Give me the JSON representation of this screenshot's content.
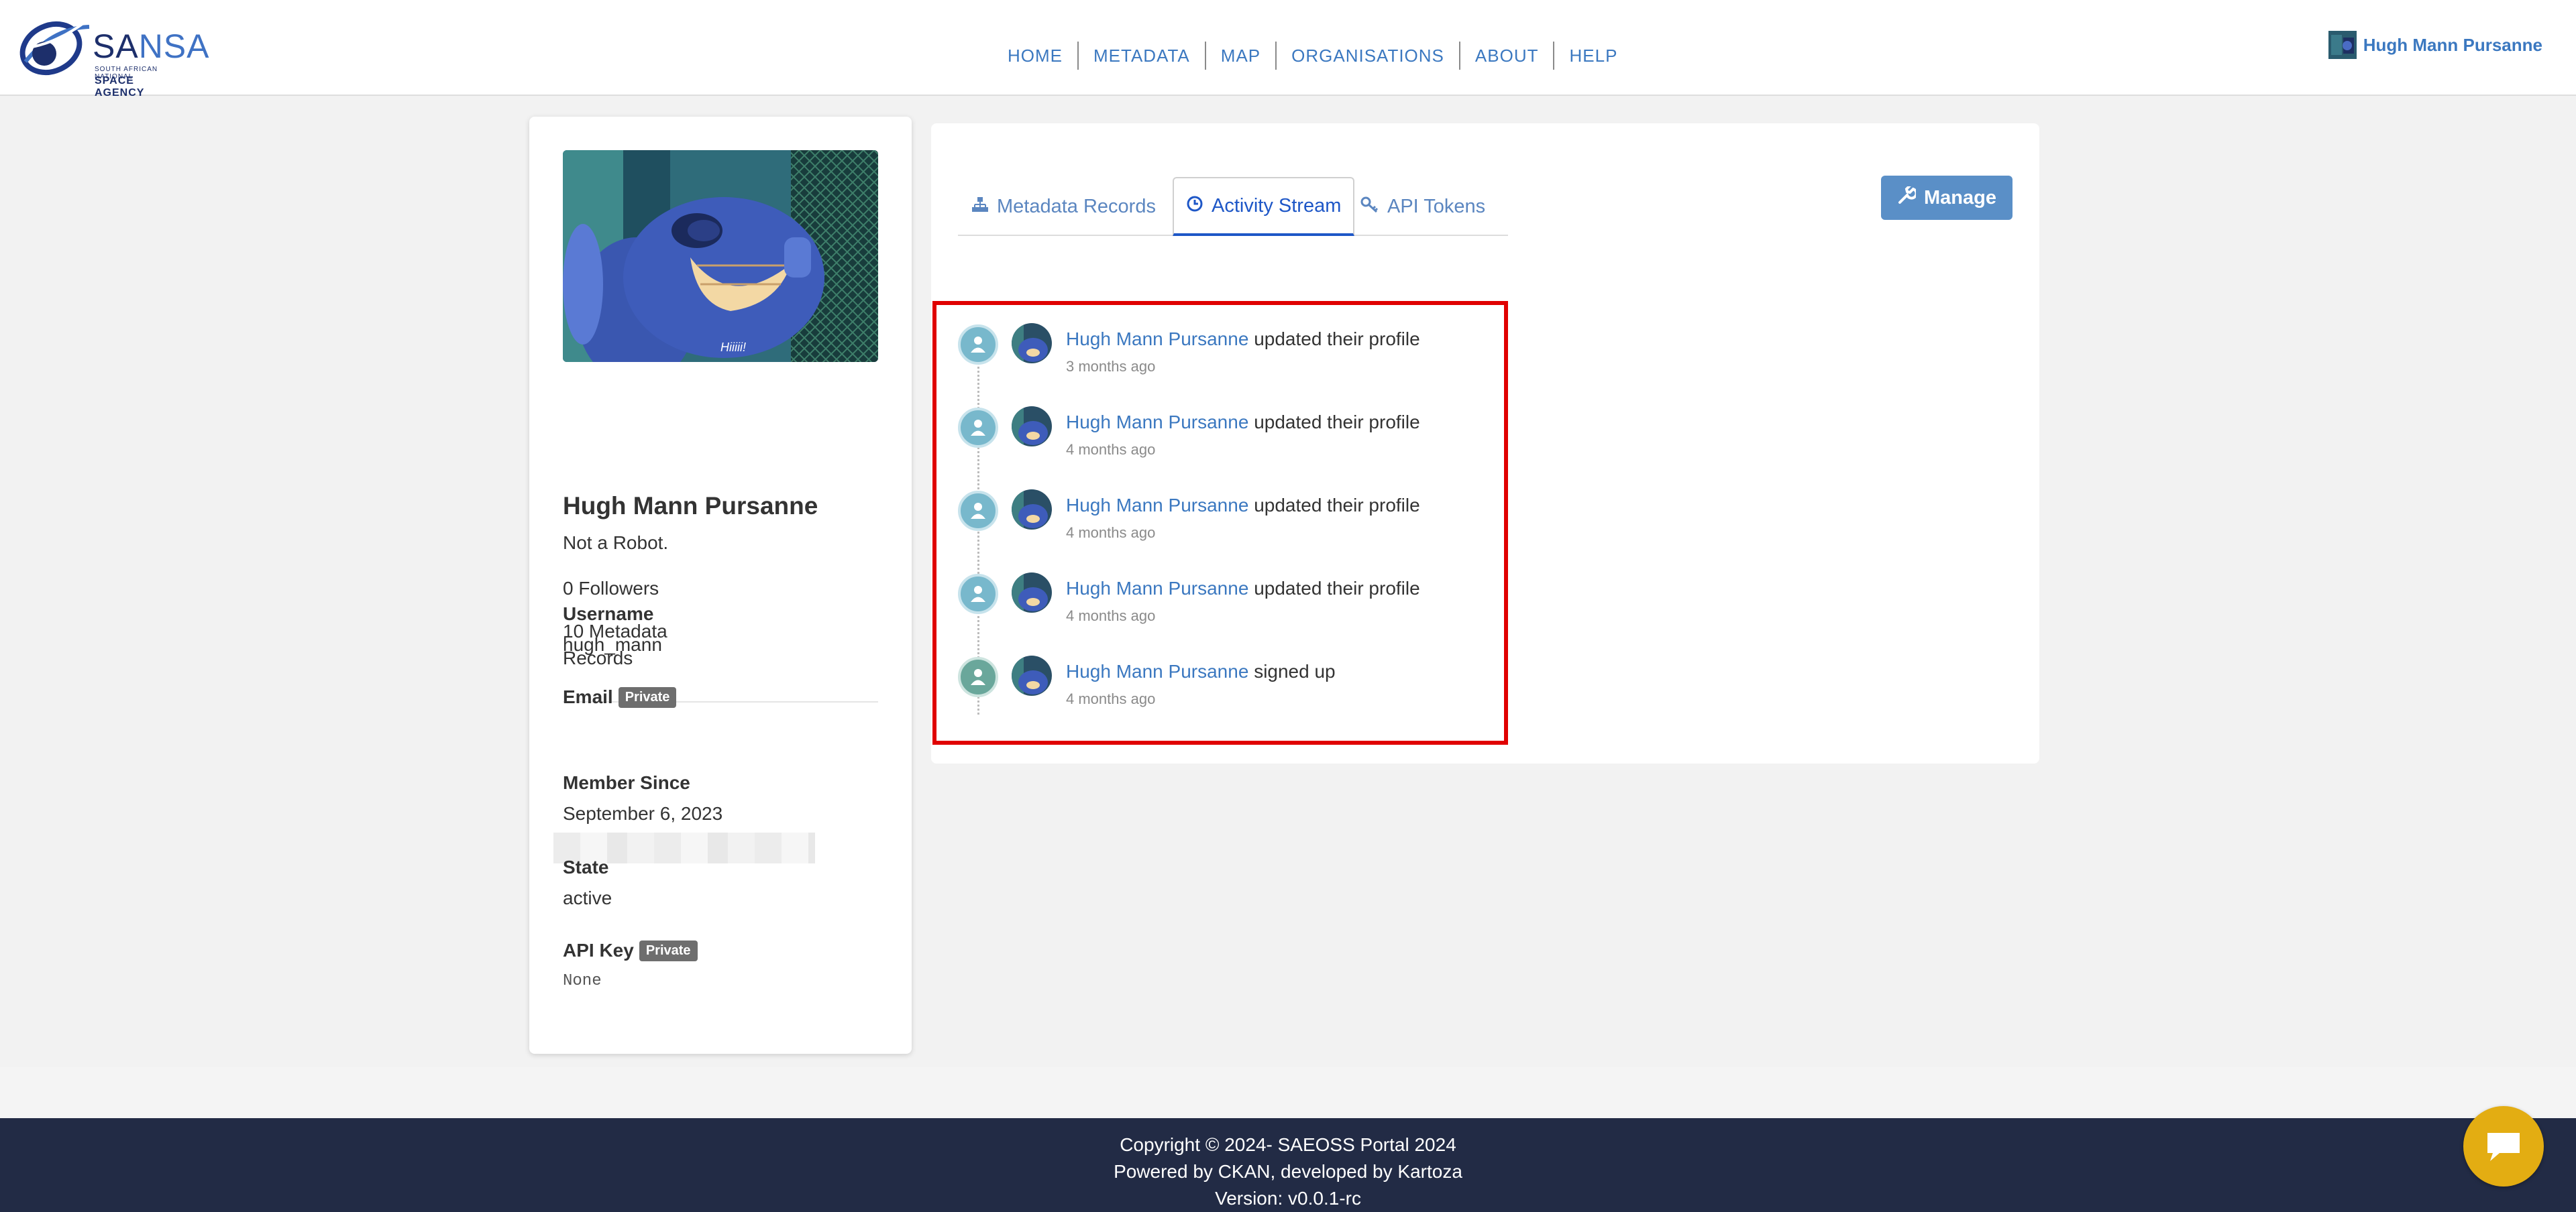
{
  "brand": {
    "logo_letters_a": "SA",
    "logo_letters_b": "NSA",
    "logo_sub1": "SOUTH AFRICAN NATIONAL",
    "logo_sub2": "SPACE AGENCY"
  },
  "nav": {
    "items": [
      "HOME",
      "METADATA",
      "MAP",
      "ORGANISATIONS",
      "ABOUT",
      "HELP"
    ]
  },
  "top_user": {
    "name": "Hugh Mann Pursanne"
  },
  "profile": {
    "image_caption": "Hiiiii!",
    "name": "Hugh Mann Pursanne",
    "about": "Not a Robot.",
    "followers": "0 Followers",
    "records": "10 Metadata Records",
    "username_label": "Username",
    "username": "hugh_mann",
    "email_label": "Email",
    "private_badge": "Private",
    "member_since_label": "Member Since",
    "member_since": "September 6, 2023",
    "state_label": "State",
    "state": "active",
    "api_key_label": "API Key",
    "api_key": "None"
  },
  "tabs": [
    {
      "label": "Metadata Records",
      "icon": "sitemap-icon"
    },
    {
      "label": "Activity Stream",
      "icon": "clock-icon"
    },
    {
      "label": "API Tokens",
      "icon": "key-icon"
    }
  ],
  "manage_button": {
    "label": "Manage",
    "icon": "wrench-icon"
  },
  "activity": [
    {
      "actor": "Hugh Mann Pursanne",
      "action": "updated their profile",
      "time": "3 months ago"
    },
    {
      "actor": "Hugh Mann Pursanne",
      "action": "updated their profile",
      "time": "4 months ago"
    },
    {
      "actor": "Hugh Mann Pursanne",
      "action": "updated their profile",
      "time": "4 months ago"
    },
    {
      "actor": "Hugh Mann Pursanne",
      "action": "updated their profile",
      "time": "4 months ago"
    },
    {
      "actor": "Hugh Mann Pursanne",
      "action": "signed up",
      "time": "4 months ago"
    }
  ],
  "footer": {
    "line1": "Copyright © 2024- SAEOSS Portal 2024",
    "line2": "Powered by CKAN, developed by Kartoza",
    "line3": "Version: v0.0.1-rc"
  },
  "colors": {
    "accent": "#3b78c0",
    "footer_bg": "#222b45",
    "highlight_border": "#e00000",
    "chat_button": "#e3ad12"
  }
}
